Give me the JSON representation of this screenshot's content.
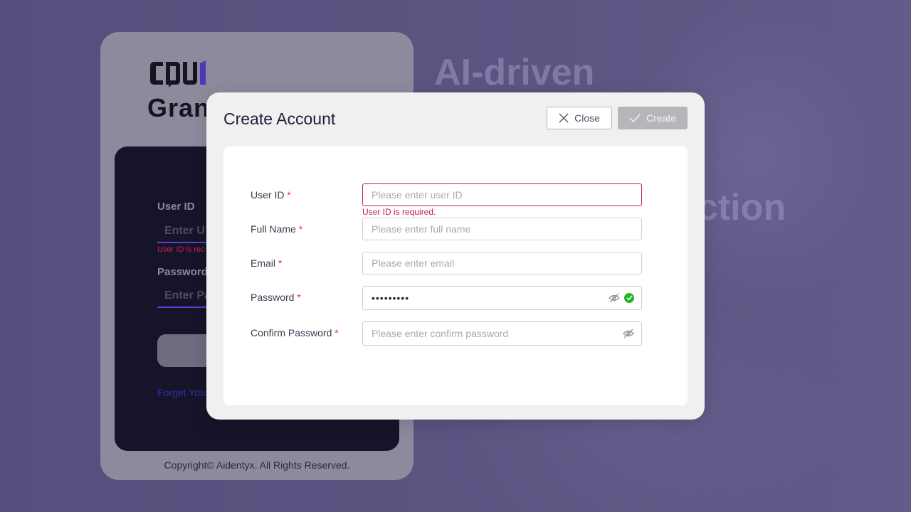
{
  "background": {
    "hero_line_1": "AI-driven",
    "hero_line_2": "ction"
  },
  "login": {
    "brand": "Gran",
    "user_id_label": "User ID",
    "user_id_placeholder": "Enter U",
    "user_id_error": "User ID is rec",
    "password_label": "Password",
    "password_placeholder": "Enter Pa",
    "forgot_link": "Forget You",
    "copyright": "Copyright© Aidentyx. All Rights Reserved."
  },
  "modal": {
    "title": "Create Account",
    "close_label": "Close",
    "create_label": "Create",
    "fields": {
      "user_id": {
        "label": "User ID",
        "required": "*",
        "placeholder": "Please enter user ID",
        "error": "User ID is required."
      },
      "full_name": {
        "label": "Full Name",
        "required": "*",
        "placeholder": "Please enter full name"
      },
      "email": {
        "label": "Email",
        "required": "*",
        "placeholder": "Please enter email"
      },
      "password": {
        "label": "Password",
        "required": "*",
        "value": "•••••••••"
      },
      "confirm_password": {
        "label": "Confirm Password",
        "required": "*",
        "placeholder": "Please enter confirm password"
      }
    }
  },
  "colors": {
    "accent_error": "#c2185b",
    "required_star": "#e5334b",
    "valid_green": "#27b327",
    "login_underline": "#5a3fd6"
  },
  "icons": {
    "close": "close-icon",
    "create": "check-icon",
    "password_toggle": "eye-off-icon",
    "password_valid": "check-circle-icon"
  }
}
